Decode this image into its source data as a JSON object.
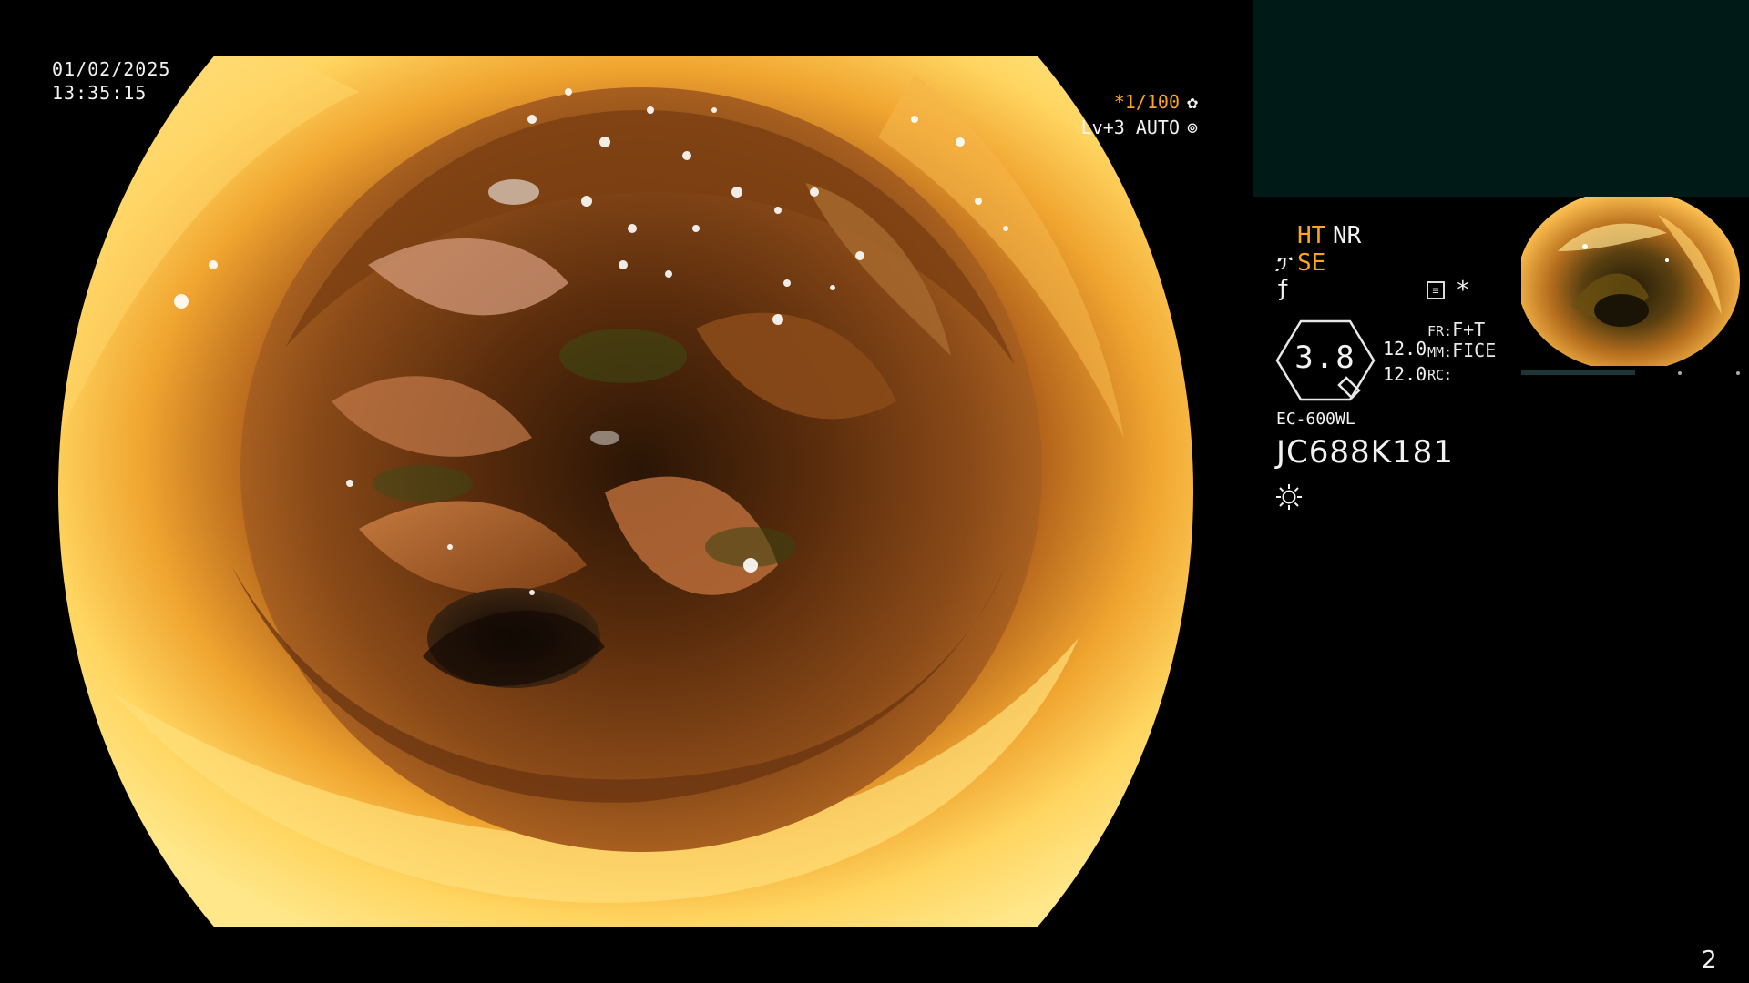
{
  "overlay": {
    "date": "01/02/2025",
    "time": "13:35:15",
    "shutter": "*1/100",
    "shutter_icon": "aperture-icon",
    "light_level": "Lv+3 AUTO",
    "light_icon": "iris-icon"
  },
  "panel": {
    "ht": "HT",
    "nr": "NR",
    "se": "SE",
    "se_icon": "signal-enhance-icon",
    "curve_icon": "curve-icon",
    "menu_icon": "menu-icon",
    "star": "*",
    "zoom": "3.8",
    "values": [
      "12.0",
      "12.0"
    ],
    "fr_label": "FR:",
    "fr_value": "F+T",
    "mm_label": "MM:",
    "mm_value": "FICE",
    "rc_label": "RC:",
    "model": "EC-600WL",
    "serial": "JC688K181",
    "light_icon": "sun-icon"
  },
  "footer": {
    "page_number": "2"
  },
  "colors": {
    "background": "#000000",
    "text": "#f2f2f2",
    "accent_orange": "#ffa51c",
    "pip_background": "#001a17"
  }
}
